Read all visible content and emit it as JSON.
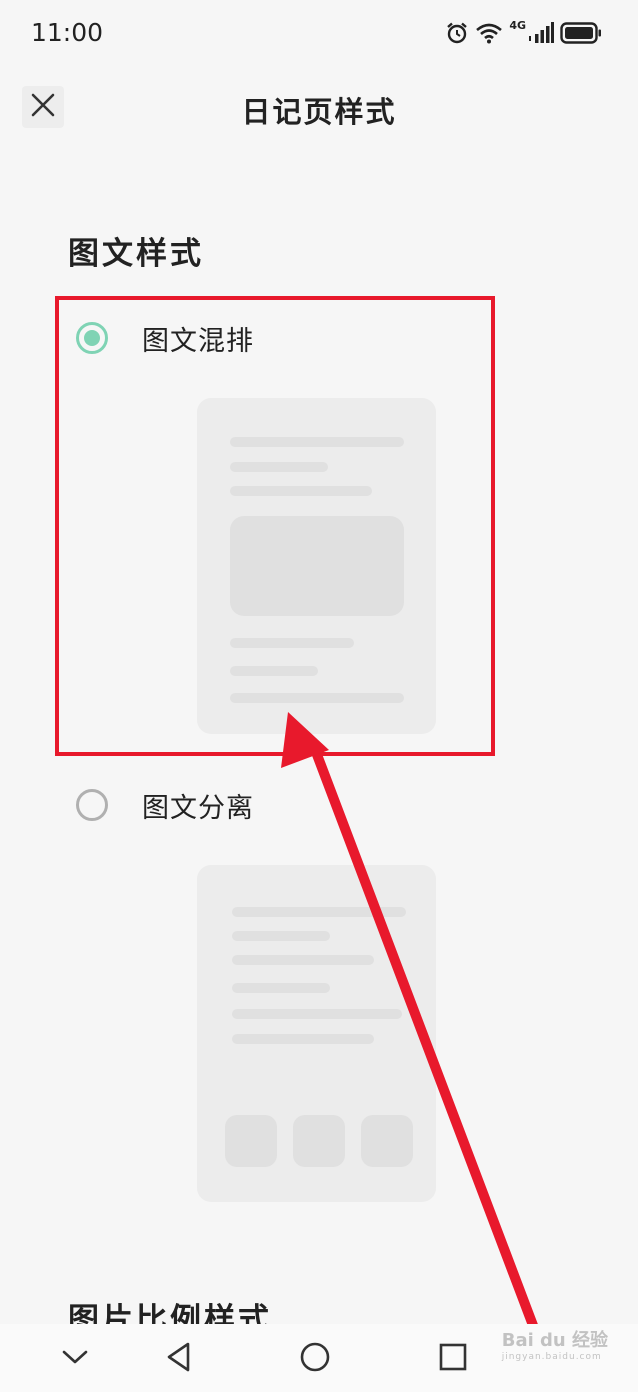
{
  "status_bar": {
    "time": "11:00",
    "network": "4G",
    "icons": [
      "alarm-icon",
      "wifi-icon",
      "signal-icon",
      "battery-icon"
    ]
  },
  "header": {
    "title": "日记页样式",
    "close_icon": "close-icon"
  },
  "sections": {
    "image_text_style": {
      "title": "图文样式",
      "options": [
        {
          "label": "图文混排",
          "selected": true
        },
        {
          "label": "图文分离",
          "selected": false
        }
      ]
    },
    "image_ratio_style": {
      "title": "图片比例样式"
    }
  },
  "navigation_bar": {
    "buttons": [
      "chevron-down-icon",
      "back-icon",
      "home-icon",
      "recents-icon"
    ]
  },
  "watermark": {
    "brand": "Bai du 经验",
    "url": "jingyan.baidu.com"
  },
  "colors": {
    "accent": "#7fd3b4",
    "annotation": "#e8192c",
    "background": "#f6f6f6"
  }
}
